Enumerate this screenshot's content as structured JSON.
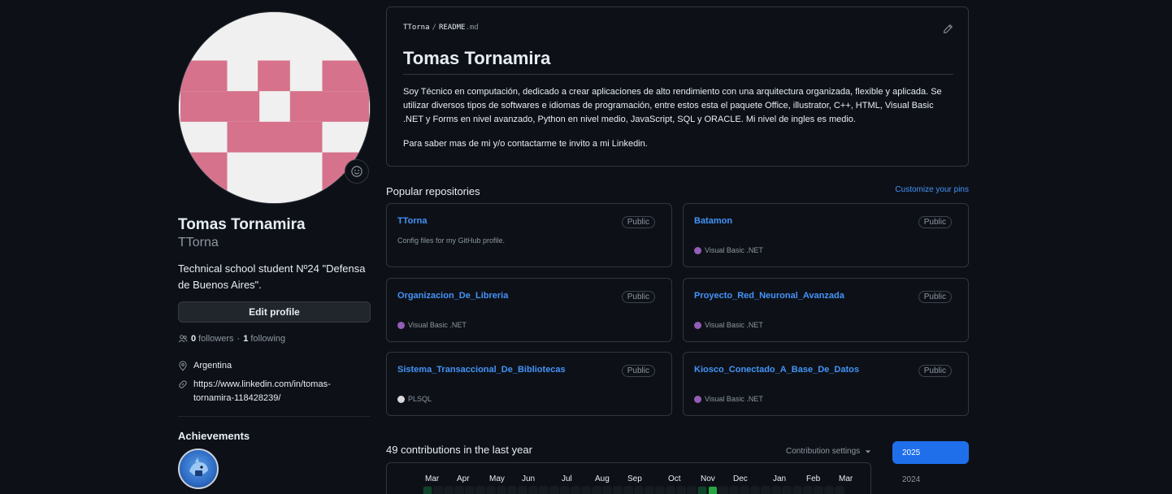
{
  "profile": {
    "name": "Tomas Tornamira",
    "username": "TTorna",
    "bio": "Technical school student Nº24 \"Defensa de Buenos Aires\".",
    "edit_label": "Edit profile",
    "followers_count": "0",
    "followers_label": "followers",
    "separator": "·",
    "following_count": "1",
    "following_label": "following",
    "location": "Argentina",
    "link": "https://www.linkedin.com/in/tomas-tornamira-118428239/",
    "achievements_title": "Achievements"
  },
  "readme": {
    "owner": "TTorna",
    "separator": "/",
    "file_base": "README",
    "file_ext": ".md",
    "heading": "Tomas Tornamira",
    "paragraph1": "Soy Técnico en computación, dedicado a crear aplicaciones de alto rendimiento con una arquitectura organizada, flexible y aplicada. Se utilizar diversos tipos de softwares e idiomas de programación, entre estos esta el paquete Office, illustrator, C++, HTML, Visual Basic .NET y Forms en nivel avanzado, Python en nivel medio, JavaScript, SQL y ORACLE. Mi nivel de ingles es medio.",
    "paragraph2": "Para saber mas de mi y/o contactarme te invito a mi Linkedin."
  },
  "popular": {
    "title": "Popular repositories",
    "customize": "Customize your pins",
    "repos": [
      {
        "name": "TTorna",
        "visibility": "Public",
        "description": "Config files for my GitHub profile.",
        "language": "",
        "lang_color": ""
      },
      {
        "name": "Batamon",
        "visibility": "Public",
        "description": "",
        "language": "Visual Basic .NET",
        "lang_color": "#945db7"
      },
      {
        "name": "Organizacion_De_Libreria",
        "visibility": "Public",
        "description": "",
        "language": "Visual Basic .NET",
        "lang_color": "#945db7"
      },
      {
        "name": "Proyecto_Red_Neuronal_Avanzada",
        "visibility": "Public",
        "description": "",
        "language": "Visual Basic .NET",
        "lang_color": "#945db7"
      },
      {
        "name": "Sistema_Transaccional_De_Bibliotecas",
        "visibility": "Public",
        "description": "",
        "language": "PLSQL",
        "lang_color": "#dad8d8"
      },
      {
        "name": "Kiosco_Conectado_A_Base_De_Datos",
        "visibility": "Public",
        "description": "",
        "language": "Visual Basic .NET",
        "lang_color": "#945db7"
      }
    ]
  },
  "contributions": {
    "title": "49 contributions in the last year",
    "settings_label": "Contribution settings",
    "months": [
      "Mar",
      "Apr",
      "May",
      "Jun",
      "Jul",
      "Aug",
      "Sep",
      "Oct",
      "Nov",
      "Dec",
      "Jan",
      "Feb",
      "Mar"
    ],
    "years": [
      "2025",
      "2024"
    ],
    "selected_year": "2025",
    "active_week_indices": [
      0,
      26,
      27
    ],
    "colors": {
      "empty": "#161b22",
      "level1": "#0e4429",
      "level3": "#26a641"
    }
  },
  "colors": {
    "background": "#0d1117",
    "border": "#30363d",
    "link": "#4493f8",
    "muted": "#8d96a0",
    "avatar_pink": "#d6728b",
    "avatar_bg": "#f0f0f0"
  }
}
